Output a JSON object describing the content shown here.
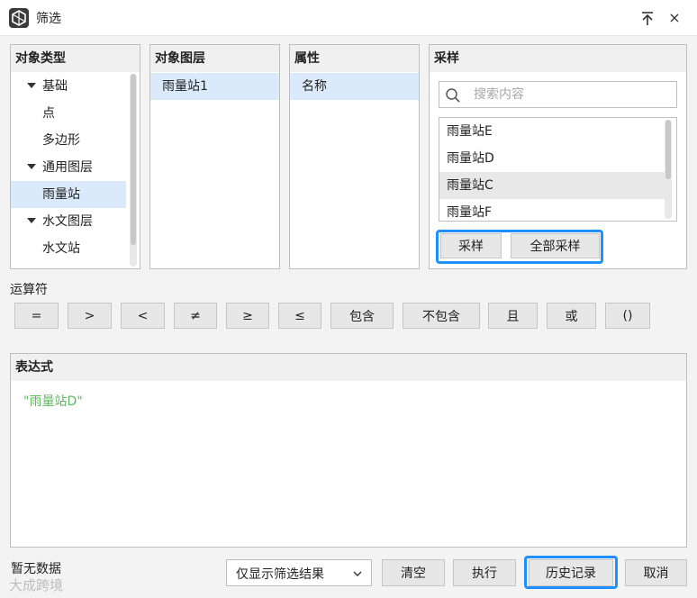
{
  "window": {
    "title": "筛选",
    "pin_icon": "pin-top-icon",
    "close_label": "×"
  },
  "object_type": {
    "header": "对象类型",
    "items": [
      {
        "label": "基础",
        "expanded": true
      },
      {
        "label": "点"
      },
      {
        "label": "多边形"
      },
      {
        "label": "通用图层",
        "expanded": true
      },
      {
        "label": "雨量站",
        "selected": true
      },
      {
        "label": "水文图层",
        "expanded": true
      },
      {
        "label": "水文站"
      }
    ]
  },
  "object_layer": {
    "header": "对象图层",
    "items": [
      "雨量站1"
    ]
  },
  "attribute": {
    "header": "属性",
    "items": [
      "名称"
    ]
  },
  "sample": {
    "header": "采样",
    "search_placeholder": "搜索内容",
    "items": [
      "雨量站E",
      "雨量站D",
      "雨量站C",
      "雨量站F"
    ],
    "sample_button": "采样",
    "sample_all_button": "全部采样"
  },
  "operators": {
    "label": "运算符",
    "buttons": [
      "=",
      ">",
      "<",
      "≠",
      "≥",
      "≤",
      "包含",
      "不包含",
      "且",
      "或",
      "()"
    ]
  },
  "expression": {
    "header": "表达式",
    "value": "\"雨量站D\""
  },
  "footer": {
    "status": "暂无数据",
    "filter_dropdown": "仅显示筛选结果",
    "clear_button": "清空",
    "execute_button": "执行",
    "history_button": "历史记录",
    "cancel_button": "取消"
  },
  "watermark": "大成跨境",
  "colors": {
    "accent": "#1e90ff",
    "expression_text": "#5cb85c",
    "selection": "#dbeafb"
  }
}
